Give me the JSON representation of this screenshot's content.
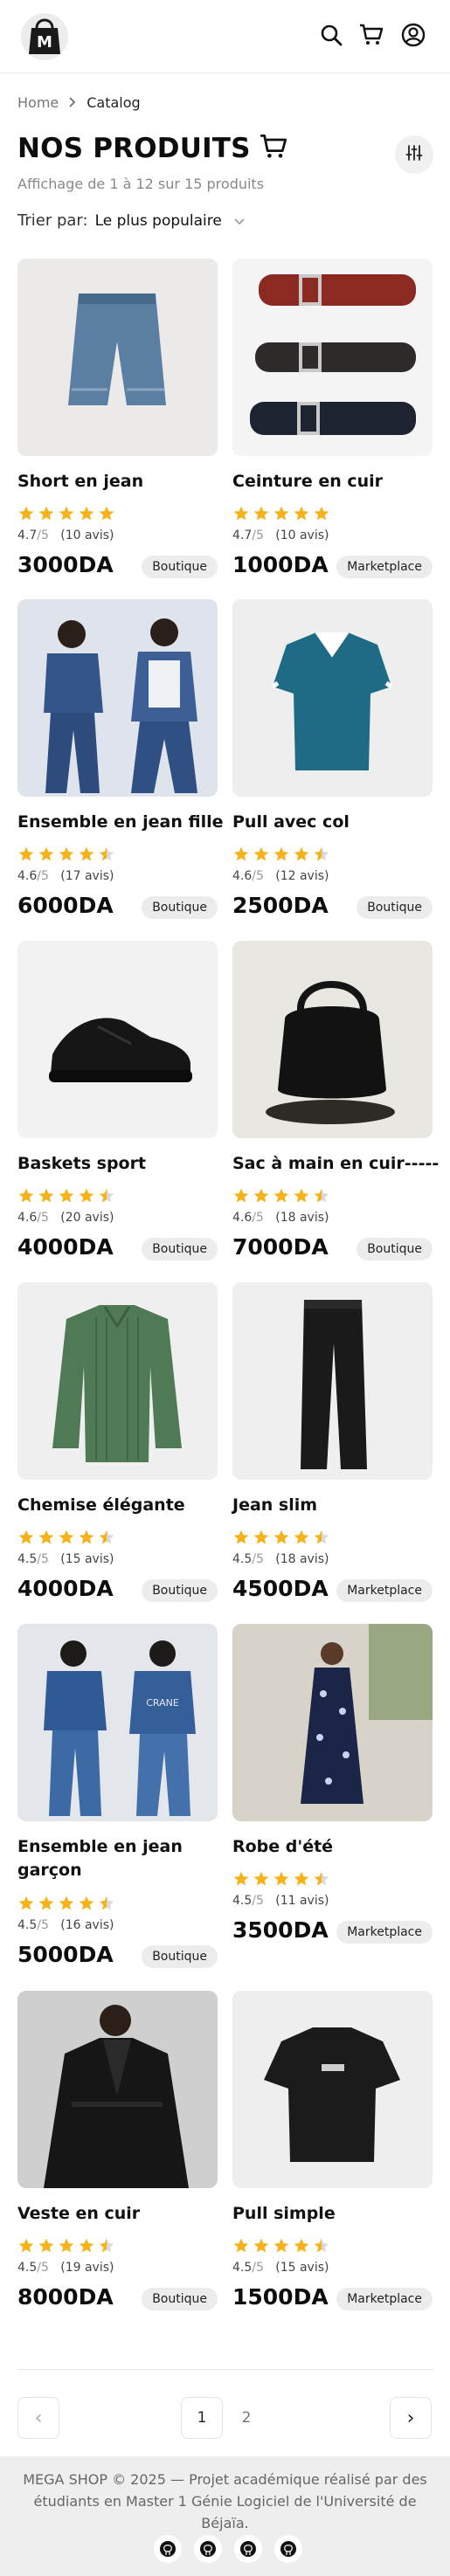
{
  "header": {
    "logo": "shopping-bag-logo",
    "icons": [
      "search-icon",
      "cart-icon",
      "user-icon"
    ]
  },
  "breadcrumb": {
    "home": "Home",
    "current": "Catalog"
  },
  "page": {
    "title": "NOS PRODUITS",
    "count": "Affichage de 1 à 12 sur 15 produits",
    "sort_label": "Trier par:",
    "sort_value": "Le plus populaire"
  },
  "products": [
    {
      "name": "Short en jean",
      "rating": "4.7",
      "of": "/5",
      "reviews": "(10 avis)",
      "stars": 5,
      "price": "3000DA",
      "badge": "Boutique",
      "image": "denim-shorts"
    },
    {
      "name": "Ceinture en cuir",
      "rating": "4.7",
      "of": "/5",
      "reviews": "(10 avis)",
      "stars": 5,
      "price": "1000DA",
      "badge": "Marketplace",
      "image": "leather-belts"
    },
    {
      "name": "Ensemble en jean fille",
      "rating": "4.6",
      "of": "/5",
      "reviews": "(17 avis)",
      "stars": 4.5,
      "price": "6000DA",
      "badge": "Boutique",
      "image": "girl-denim-set"
    },
    {
      "name": "Pull avec col",
      "rating": "4.6",
      "of": "/5",
      "reviews": "(12 avis)",
      "stars": 4.5,
      "price": "2500DA",
      "badge": "Boutique",
      "image": "teal-polo"
    },
    {
      "name": "Baskets sport",
      "rating": "4.6",
      "of": "/5",
      "reviews": "(20 avis)",
      "stars": 4.5,
      "price": "4000DA",
      "badge": "Boutique",
      "image": "black-sneakers"
    },
    {
      "name": "Sac à main en cuir-----",
      "rating": "4.6",
      "of": "/5",
      "reviews": "(18 avis)",
      "stars": 4.5,
      "price": "7000DA",
      "badge": "Boutique",
      "image": "black-handbag"
    },
    {
      "name": "Chemise élégante",
      "rating": "4.5",
      "of": "/5",
      "reviews": "(15 avis)",
      "stars": 4.5,
      "price": "4000DA",
      "badge": "Boutique",
      "image": "green-shirt"
    },
    {
      "name": "Jean slim",
      "rating": "4.5",
      "of": "/5",
      "reviews": "(18 avis)",
      "stars": 4.5,
      "price": "4500DA",
      "badge": "Marketplace",
      "image": "black-jeans"
    },
    {
      "name": "Ensemble en jean garçon",
      "rating": "4.5",
      "of": "/5",
      "reviews": "(16 avis)",
      "stars": 4.5,
      "price": "5000DA",
      "badge": "Boutique",
      "image": "boy-denim-set"
    },
    {
      "name": "Robe d'été",
      "rating": "4.5",
      "of": "/5",
      "reviews": "(11 avis)",
      "stars": 4.5,
      "price": "3500DA",
      "badge": "Marketplace",
      "image": "floral-dress"
    },
    {
      "name": "Veste en cuir",
      "rating": "4.5",
      "of": "/5",
      "reviews": "(19 avis)",
      "stars": 4.5,
      "price": "8000DA",
      "badge": "Boutique",
      "image": "leather-jacket"
    },
    {
      "name": "Pull simple",
      "rating": "4.5",
      "of": "/5",
      "reviews": "(15 avis)",
      "stars": 4.5,
      "price": "1500DA",
      "badge": "Marketplace",
      "image": "black-tshirt"
    }
  ],
  "pagination": {
    "prev": "‹",
    "next": "›",
    "pages": [
      "1",
      "2"
    ],
    "current": "1"
  },
  "footer": {
    "text": "MEGA SHOP © 2025 — Projet académique réalisé par des étudiants en Master 1 Génie Logiciel de l'Université de Béjaïa.",
    "social_icons": [
      "github-icon",
      "github-icon",
      "github-icon",
      "github-icon"
    ]
  },
  "colors": {
    "star": "#F5B21B",
    "badge_bg": "#ECECEC",
    "footer_bg": "#EEEEEE"
  }
}
